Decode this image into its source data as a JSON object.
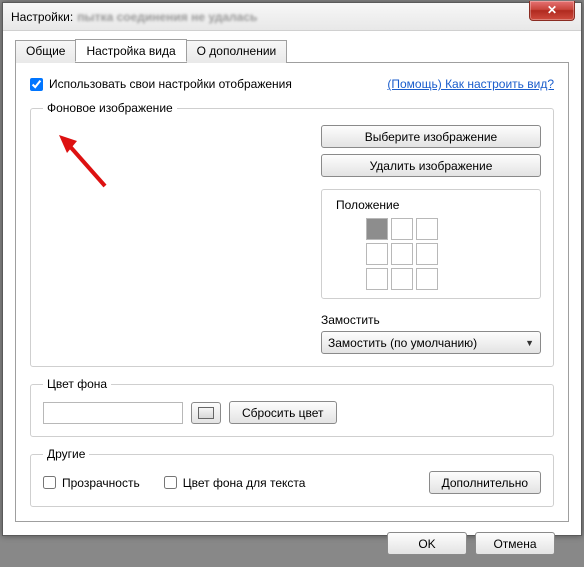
{
  "window": {
    "title": "Настройки:",
    "blurred_subtitle": "пытка соединения не удалась"
  },
  "tabs": {
    "general": "Общие",
    "view": "Настройка вида",
    "about": "О дополнении"
  },
  "panel": {
    "use_own_label": "Использовать свои настройки отображения",
    "help_link": "(Помощь) Как настроить вид?"
  },
  "bg_section": {
    "legend": "Фоновое изображение",
    "choose_btn": "Выберите изображение",
    "delete_btn": "Удалить изображение",
    "position_label": "Положение",
    "tile_label": "Замостить",
    "tile_value": "Замостить (по умолчанию)"
  },
  "color_section": {
    "legend": "Цвет фона",
    "reset_btn": "Сбросить цвет"
  },
  "other_section": {
    "legend": "Другие",
    "transparency": "Прозрачность",
    "text_bg": "Цвет фона для текста",
    "advanced_btn": "Дополнительно"
  },
  "footer": {
    "ok": "OK",
    "cancel": "Отмена"
  }
}
